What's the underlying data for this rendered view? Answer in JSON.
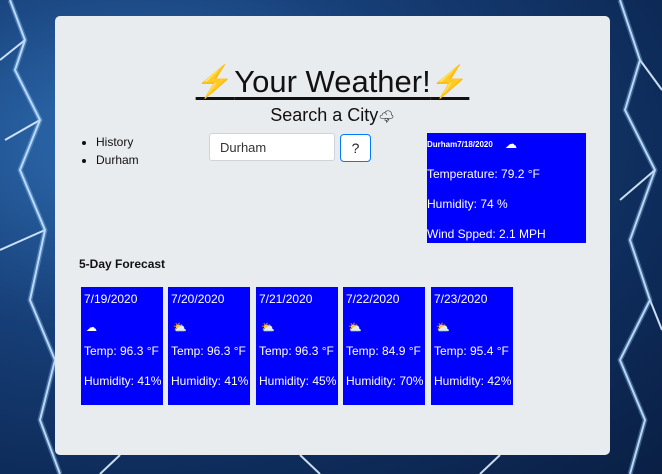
{
  "header": {
    "bolt": "⚡",
    "title": "Your Weather!",
    "subtitle": "Search a City",
    "subtitle_icon": "🌩"
  },
  "history": [
    "History",
    "Durham"
  ],
  "search": {
    "value": "Durham",
    "button_icon": "?"
  },
  "current": {
    "city_date": "Durham7/18/2020",
    "icon": "cloud-icon",
    "temperature": "Temperature: 79.2 °F",
    "humidity": "Humidity: 74 %",
    "wind": "Wind Spped: 2.1 MPH"
  },
  "forecast_title": "5-Day Forecast",
  "forecast": [
    {
      "date": "7/19/2020",
      "icon": "cloud-icon",
      "temp": "Temp: 96.3 °F",
      "humidity": "Humidity: 41%"
    },
    {
      "date": "7/20/2020",
      "icon": "sun-cloud-icon",
      "temp": "Temp: 96.3 °F",
      "humidity": "Humidity: 41%"
    },
    {
      "date": "7/21/2020",
      "icon": "sun-cloud-icon",
      "temp": "Temp: 96.3 °F",
      "humidity": "Humidity: 45%"
    },
    {
      "date": "7/22/2020",
      "icon": "sun-cloud-icon",
      "temp": "Temp: 84.9 °F",
      "humidity": "Humidity: 70%"
    },
    {
      "date": "7/23/2020",
      "icon": "sun-cloud-icon",
      "temp": "Temp: 95.4 °F",
      "humidity": "Humidity: 42%"
    }
  ],
  "colors": {
    "card_bg": "#e9ecef",
    "panel_blue": "#0000ff",
    "button_border": "#007bff"
  }
}
